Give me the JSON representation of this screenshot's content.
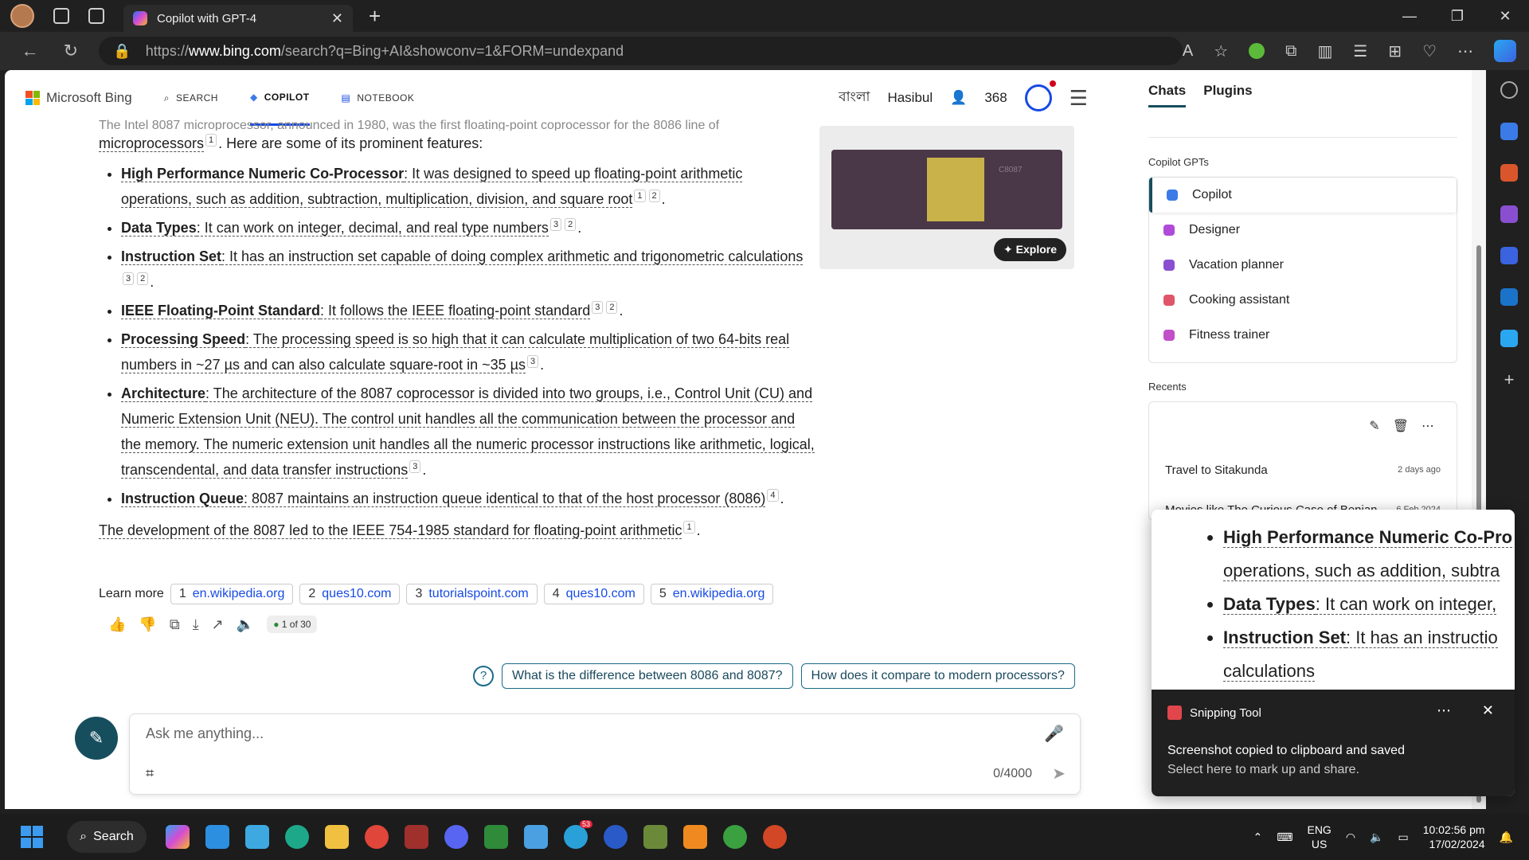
{
  "browser": {
    "tab_title": "Copilot with GPT-4",
    "url_prefix": "https://",
    "url_host": "www.bing.com",
    "url_path": "/search?q=Bing+AI&showconv=1&FORM=undexpand"
  },
  "header": {
    "logo": "Microsoft Bing",
    "tabs": [
      "SEARCH",
      "COPILOT",
      "NOTEBOOK"
    ],
    "language": "বাংলা",
    "user": "Hasibul",
    "points": "368"
  },
  "answer": {
    "intro_cut": "The Intel 8087 microprocessor, announced in 1980, was the first floating-point coprocessor for the 8086 line of",
    "intro_u": "microprocessors",
    "intro_rest": ". Here are some of its prominent features:",
    "items": [
      {
        "b": "High Performance Numeric Co-Processor",
        "t": ": It was designed to speed up floating-point arithmetic operations, such as addition, subtraction, multiplication, division, and square root",
        "c": [
          "1",
          "2"
        ]
      },
      {
        "b": "Data Types",
        "t": ": It can work on integer, decimal, and real type numbers",
        "c": [
          "3",
          "2"
        ]
      },
      {
        "b": "Instruction Set",
        "t": ": It has an instruction set capable of doing complex arithmetic and trigonometric calculations",
        "c": [
          "3",
          "2"
        ]
      },
      {
        "b": "IEEE Floating-Point Standard",
        "t": ": It follows the IEEE floating-point standard",
        "c": [
          "3",
          "2"
        ]
      },
      {
        "b": "Processing Speed",
        "t": ": The processing speed is so high that it can calculate multiplication of two 64-bits real numbers in ~27 µs and can also calculate square-root in ~35 µs",
        "c": [
          "3"
        ]
      },
      {
        "b": "Architecture",
        "t": ": The architecture of the 8087 coprocessor is divided into two groups, i.e., Control Unit (CU) and Numeric Extension Unit (NEU). The control unit handles all the communication between the processor and the memory. The numeric extension unit handles all the numeric processor instructions like arithmetic, logical, transcendental, and data transfer instructions",
        "c": [
          "3"
        ]
      },
      {
        "b": "Instruction Queue",
        "t": ": 8087 maintains an instruction queue identical to that of the host processor (8086)",
        "c": [
          "4"
        ]
      }
    ],
    "closing": "The development of the 8087 led to the IEEE 754-1985 standard for floating-point arithmetic",
    "closing_cite": "1"
  },
  "image_card": {
    "chip_label": "C8087",
    "explore": "Explore"
  },
  "learn_more": {
    "label": "Learn more",
    "links": [
      {
        "n": "1",
        "t": "en.wikipedia.org"
      },
      {
        "n": "2",
        "t": "ques10.com"
      },
      {
        "n": "3",
        "t": "tutorialspoint.com"
      },
      {
        "n": "4",
        "t": "ques10.com"
      },
      {
        "n": "5",
        "t": "en.wikipedia.org"
      }
    ]
  },
  "response_counter": "1 of 30",
  "suggestions": [
    "What is the difference between 8086 and 8087?",
    "How does it compare to modern processors?"
  ],
  "input": {
    "placeholder": "Ask me anything...",
    "count": "0/4000"
  },
  "right_panel": {
    "tabs": [
      "Chats",
      "Plugins"
    ],
    "gpts_label": "Copilot GPTs",
    "gpts": [
      {
        "name": "Copilot",
        "color": "#3b7be8"
      },
      {
        "name": "Designer",
        "color": "#b04ad8"
      },
      {
        "name": "Vacation planner",
        "color": "#8a4fd0"
      },
      {
        "name": "Cooking assistant",
        "color": "#e0556a"
      },
      {
        "name": "Fitness trainer",
        "color": "#c04fc8"
      }
    ],
    "recents_label": "Recents",
    "recents": [
      {
        "title": "Travel to Sitakunda",
        "date": "2 days ago"
      },
      {
        "title": "Movies like The Curious Case of Benjan",
        "date": "6 Feb 2024"
      }
    ]
  },
  "notification": {
    "zoom_items": [
      {
        "b": "High Performance Numeric Co-Pro",
        "t": ""
      },
      {
        "b": "",
        "t": "operations, such as addition, subtra"
      },
      {
        "b": "Data Types",
        "t": ": It can work on integer,"
      },
      {
        "b": "Instruction Set",
        "t": ": It has an instructio"
      },
      {
        "b": "",
        "t": "calculations"
      }
    ],
    "app": "Snipping Tool",
    "message": "Screenshot copied to clipboard and saved",
    "sub": "Select here to mark up and share."
  },
  "taskbar": {
    "search": "Search",
    "lang1": "ENG",
    "lang2": "US",
    "time": "10:02:56 pm",
    "date": "17/02/2024",
    "badge": "53"
  }
}
